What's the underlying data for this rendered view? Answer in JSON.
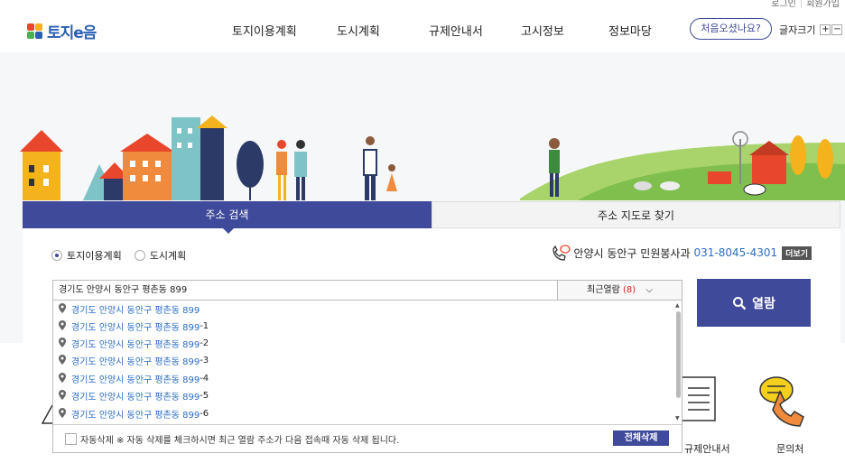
{
  "header": {
    "util_links": [
      "로그인",
      "회원가입"
    ],
    "logo_text": "토지e음",
    "nav": [
      "토지이용계획",
      "도시계획",
      "규제안내서",
      "고시정보",
      "정보마당"
    ],
    "first_visit": "처음오셨나요?",
    "font_size_label": "글자크기",
    "font_plus": "+",
    "font_minus": "−"
  },
  "tabs": [
    "주소 검색",
    "주소 지도로 찾기"
  ],
  "search": {
    "radio_options": [
      "토지이용계획",
      "도시계획"
    ],
    "selected_radio": "토지이용계획",
    "contact_office": "안양시 동안구 민원봉사과",
    "contact_phone": "031-8045-4301",
    "more_label": "더보기",
    "input_value": "경기도 안양시 동안구 평촌동 899",
    "recent_label": "최근열람",
    "recent_count": "(8)",
    "open_label": "열람"
  },
  "dropdown": {
    "items": [
      {
        "base": "경기도 안양시 동안구 평촌동 899",
        "suffix": ""
      },
      {
        "base": "경기도 안양시 동안구 평촌동 899",
        "suffix": "-1"
      },
      {
        "base": "경기도 안양시 동안구 평촌동 899",
        "suffix": "-2"
      },
      {
        "base": "경기도 안양시 동안구 평촌동 899",
        "suffix": "-3"
      },
      {
        "base": "경기도 안양시 동안구 평촌동 899",
        "suffix": "-4"
      },
      {
        "base": "경기도 안양시 동안구 평촌동 899",
        "suffix": "-5"
      },
      {
        "base": "경기도 안양시 동안구 평촌동 899",
        "suffix": "-6"
      }
    ],
    "auto_delete_label": "자동삭제 ※ 자동 삭제를 체크하시면 최근 열람 주소가 다음 접속때 자동 삭제 됩니다.",
    "delete_all": "전체삭제"
  },
  "quick_links": [
    "규제안내서",
    "문의처"
  ],
  "colors": {
    "primary": "#3f4a9a",
    "link": "#2b6cc4",
    "logo": "#2b5fb4"
  }
}
